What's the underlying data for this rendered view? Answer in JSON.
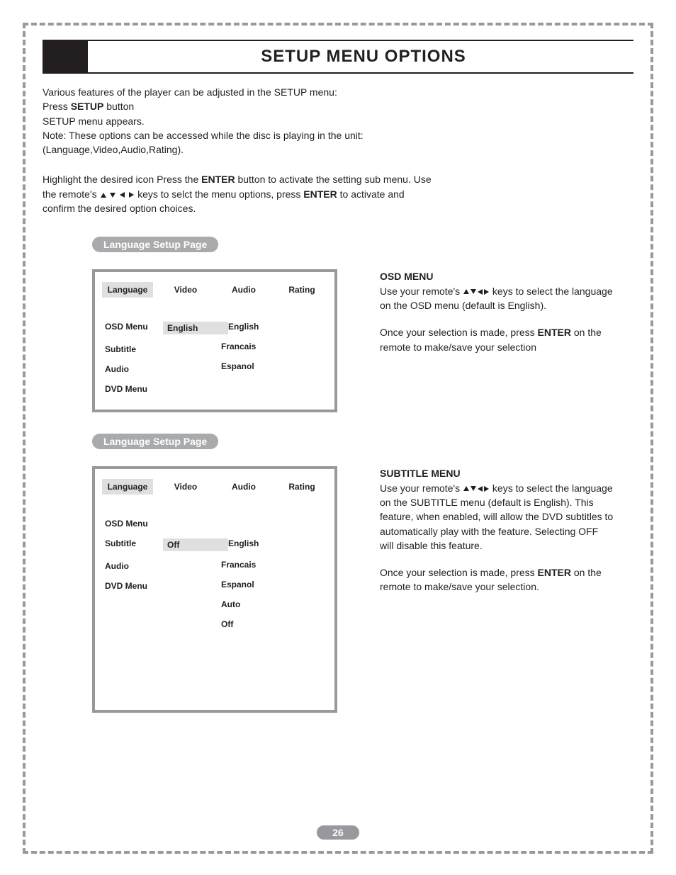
{
  "title": "SETUP MENU OPTIONS",
  "intro": {
    "line1": "Various features of the player can be adjusted in the SETUP menu:",
    "line2a": "Press ",
    "line2b": "SETUP",
    "line2c": " button",
    "line3": "SETUP menu appears.",
    "line4": "Note: These options can be accessed while the disc is playing in the unit:",
    "line5": "(Language,Video,Audio,Rating)."
  },
  "para2": {
    "a": "Highlight the desired icon Press the ",
    "b": "ENTER",
    "c": " button to activate the setting sub menu. Use the remote's ",
    "d": " keys to selct the menu options, press ",
    "e": "ENTER",
    "f": " to activate and confirm the desired option choices."
  },
  "sections": [
    {
      "pill": "Language Setup Page",
      "tabs": [
        "Language",
        "Video",
        "Audio",
        "Rating"
      ],
      "active_tab": 0,
      "left_items": [
        "OSD Menu",
        "Subtitle",
        "Audio",
        "DVD Menu"
      ],
      "selected_row": 0,
      "selected_value": "English",
      "options": [
        "English",
        "Francais",
        "Espanol"
      ],
      "right_heading": "OSD MENU",
      "right_p1a": "Use your remote's ",
      "right_p1b": " keys to select the language on the OSD menu (default is English).",
      "right_p2a": "Once your selection is made, press ",
      "right_p2b": "ENTER",
      "right_p2c": " on the remote to make/save your selection"
    },
    {
      "pill": "Language Setup Page",
      "tabs": [
        "Language",
        "Video",
        "Audio",
        "Rating"
      ],
      "active_tab": 0,
      "left_items": [
        "OSD Menu",
        "Subtitle",
        "Audio",
        "DVD Menu"
      ],
      "selected_row": 1,
      "selected_value": "Off",
      "options": [
        "English",
        "Francais",
        "Espanol",
        "Auto",
        "Off"
      ],
      "right_heading": "SUBTITLE MENU",
      "right_p1a": "Use your remote's ",
      "right_p1b": " keys to select the language on the SUBTITLE menu (default is English). This feature, when enabled, will allow the DVD subtitles to automatically play with the feature. Selecting OFF will disable this feature.",
      "right_p2a": "Once your selection is made, press ",
      "right_p2b": "ENTER",
      "right_p2c": " on the remote to make/save your selection."
    }
  ],
  "page_number": "26"
}
